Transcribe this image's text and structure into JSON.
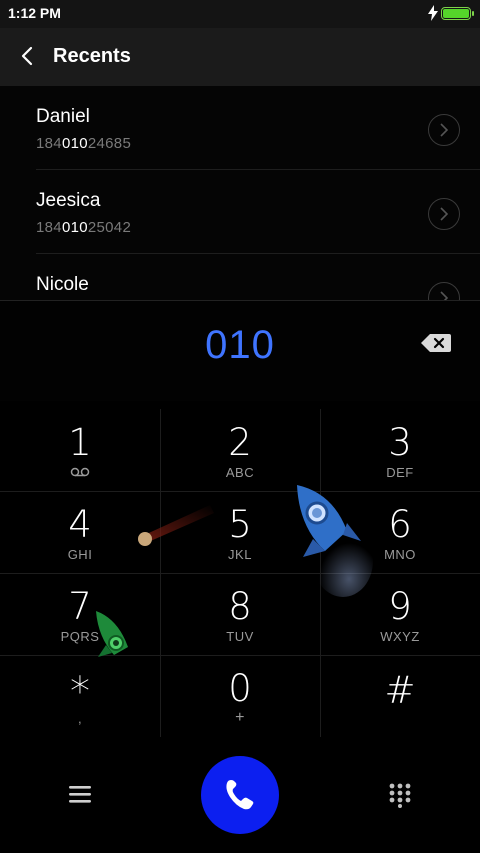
{
  "status_bar": {
    "time": "1:12 PM"
  },
  "header": {
    "title": "Recents"
  },
  "recents": [
    {
      "name": "Daniel",
      "number_prefix": "184",
      "number_match": "010",
      "number_suffix": "24685"
    },
    {
      "name": "Jeesica",
      "number_prefix": "184",
      "number_match": "010",
      "number_suffix": "25042"
    },
    {
      "name": "Nicole",
      "number_prefix": "",
      "number_match": "",
      "number_suffix": ""
    }
  ],
  "dial_input": {
    "value": "010"
  },
  "keypad": [
    {
      "digit": "1",
      "letters": ""
    },
    {
      "digit": "2",
      "letters": "ABC"
    },
    {
      "digit": "3",
      "letters": "DEF"
    },
    {
      "digit": "4",
      "letters": "GHI"
    },
    {
      "digit": "5",
      "letters": "JKL"
    },
    {
      "digit": "6",
      "letters": "MNO"
    },
    {
      "digit": "7",
      "letters": "PQRS"
    },
    {
      "digit": "8",
      "letters": "TUV"
    },
    {
      "digit": "9",
      "letters": "WXYZ"
    },
    {
      "digit": "*",
      "letters": ","
    },
    {
      "digit": "0",
      "letters": "+"
    },
    {
      "digit": "#",
      "letters": ""
    }
  ],
  "icons": {
    "back": "back-arrow-icon",
    "voicemail": "voicemail-icon",
    "delete": "backspace-icon",
    "menu": "hamburger-menu-icon",
    "call": "phone-icon",
    "dialpad": "dialpad-icon"
  },
  "colors": {
    "accent": "#3f74ff",
    "call_button": "#0c1ff0",
    "battery": "#55d52a"
  }
}
